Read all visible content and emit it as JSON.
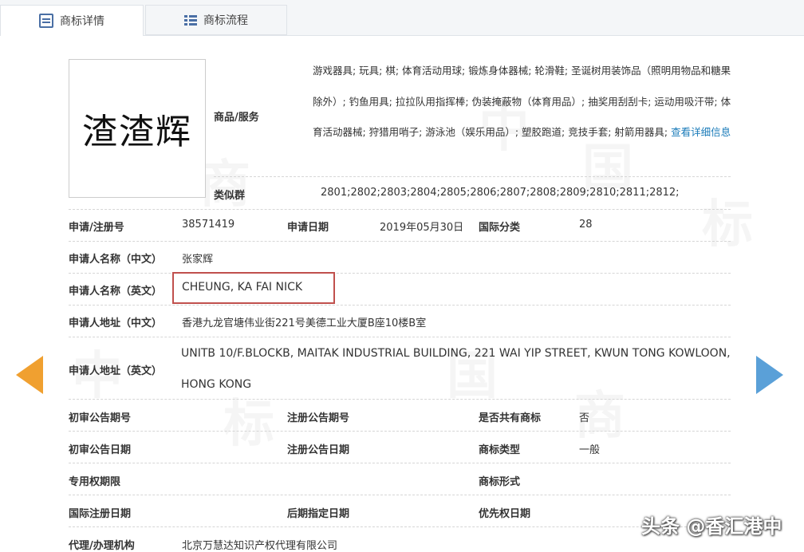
{
  "tabs": [
    {
      "label": "商标详情",
      "active": true
    },
    {
      "label": "商标流程",
      "active": false
    }
  ],
  "watermark": {
    "texts": [
      "中",
      "国",
      "商",
      "标",
      "中",
      "国",
      "商",
      "标"
    ]
  },
  "trademark": {
    "image_text": "渣渣辉"
  },
  "goods_services": {
    "label": "商品/服务",
    "text": "游戏器具; 玩具; 棋; 体育活动用球; 锻炼身体器械; 轮滑鞋; 圣诞树用装饰品（照明用物品和糖果除外）; 钓鱼用具; 拉拉队用指挥棒; 伪装掩蔽物（体育用品）; 抽奖用刮刮卡; 运动用吸汗带; 体育活动器械; 狩猎用哨子; 游泳池（娱乐用品）; 塑胶跑道; 竞技手套; 射箭用器具;",
    "link": "查看详细信息"
  },
  "similar_groups": {
    "label": "类似群",
    "value": "2801;2802;2803;2804;2805;2806;2807;2808;2809;2810;2811;2812;"
  },
  "details": {
    "reg_no_label": "申请/注册号",
    "reg_no": "38571419",
    "apply_date_label": "申请日期",
    "apply_date": "2019年05月30日",
    "intl_class_label": "国际分类",
    "intl_class": "28",
    "applicant_cn_label": "申请人名称（中文）",
    "applicant_cn": "张家辉",
    "applicant_en_label": "申请人名称（英文）",
    "applicant_en": "CHEUNG, KA FAI NICK",
    "address_cn_label": "申请人地址（中文）",
    "address_cn": "香港九龙官塘伟业街221号美德工业大厦B座10楼B室",
    "address_en_label": "申请人地址（英文）",
    "address_en": "UNITB 10/F.BLOCKB, MAITAK INDUSTRIAL BUILDING, 221 WAI YIP STREET, KWUN TONG KOWLOON, HONG KONG",
    "prelim_pub_no_label": "初审公告期号",
    "reg_pub_no_label": "注册公告期号",
    "shared_label": "是否共有商标",
    "shared": "否",
    "prelim_pub_date_label": "初审公告日期",
    "reg_pub_date_label": "注册公告日期",
    "tm_type_label": "商标类型",
    "tm_type": "一般",
    "exclusive_period_label": "专用权期限",
    "tm_form_label": "商标形式",
    "intl_reg_date_label": "国际注册日期",
    "later_designation_label": "后期指定日期",
    "priority_date_label": "优先权日期",
    "agent_label": "代理/办理机构",
    "agent": "北京万慧达知识产权代理有限公司"
  },
  "signature": "头条 @香汇港中"
}
